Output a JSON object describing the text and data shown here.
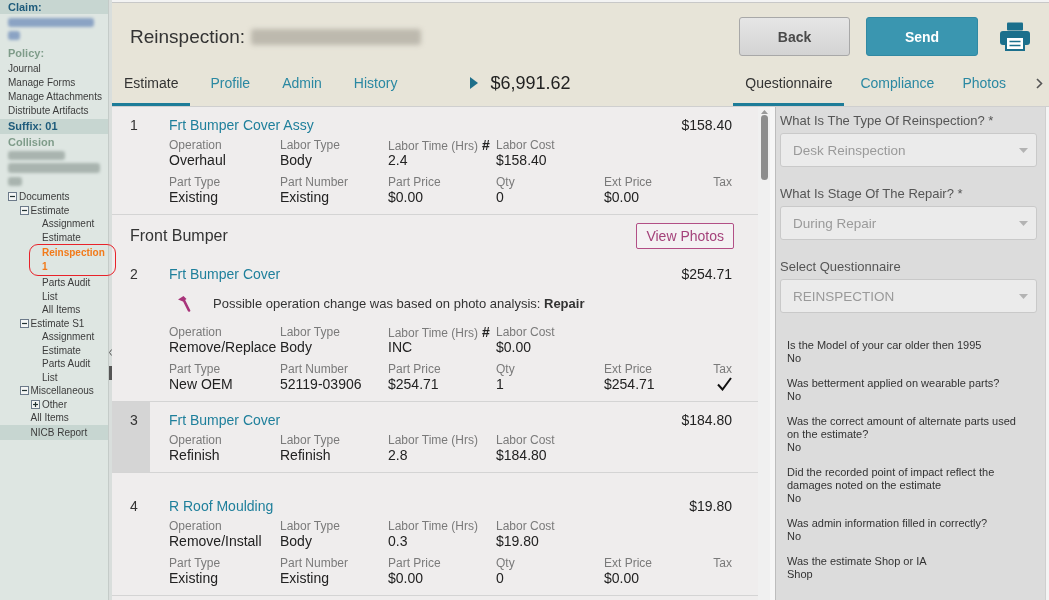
{
  "sidebar": {
    "claim_label": "Claim:",
    "policy_label": "Policy:",
    "policy_links": [
      "Journal",
      "Manage Forms",
      "Manage Attachments",
      "Distribute Artifacts"
    ],
    "suffix_label": "Suffix: 01",
    "loss_type": "Collision",
    "tree": [
      {
        "label": "Documents",
        "expanded": true,
        "selected": false,
        "hovered": false,
        "annotated": false,
        "children": [
          {
            "label": "Estimate",
            "expanded": true,
            "selected": false,
            "hovered": false,
            "annotated": false,
            "children": [
              {
                "label": "Assignment",
                "selected": false,
                "hovered": false,
                "annotated": false
              },
              {
                "label": "Estimate",
                "selected": false,
                "hovered": false,
                "annotated": false
              },
              {
                "label": "Reinspection 1",
                "selected": true,
                "hovered": false,
                "annotated": true
              },
              {
                "label": "Parts Audit List",
                "selected": false,
                "hovered": false,
                "annotated": false
              },
              {
                "label": "All Items",
                "selected": false,
                "hovered": false,
                "annotated": false
              }
            ]
          },
          {
            "label": "Estimate S1",
            "expanded": true,
            "selected": false,
            "hovered": false,
            "annotated": false,
            "children": [
              {
                "label": "Assignment",
                "selected": false,
                "hovered": false,
                "annotated": false
              },
              {
                "label": "Estimate",
                "selected": false,
                "hovered": false,
                "annotated": false
              },
              {
                "label": "Parts Audit List",
                "selected": false,
                "hovered": false,
                "annotated": false
              }
            ]
          },
          {
            "label": "Miscellaneous",
            "expanded": true,
            "selected": false,
            "hovered": false,
            "annotated": false,
            "children": [
              {
                "label": "Other",
                "expanded": false,
                "selected": false,
                "hovered": false,
                "annotated": false
              }
            ]
          },
          {
            "label": "All Items",
            "selected": false,
            "hovered": false,
            "annotated": false
          },
          {
            "label": "NICB Report",
            "selected": false,
            "hovered": true,
            "annotated": false
          }
        ]
      }
    ]
  },
  "header": {
    "title": "Reinspection:",
    "buttons": [
      {
        "label": "Back",
        "kind": "secondary"
      },
      {
        "label": "Send",
        "kind": "primary"
      }
    ],
    "tabs": [
      {
        "label": "Estimate",
        "selected": true
      },
      {
        "label": "Profile",
        "selected": false
      },
      {
        "label": "Admin",
        "selected": false
      },
      {
        "label": "History",
        "selected": false
      }
    ],
    "total": "$6,991.62",
    "side_tabs": [
      {
        "label": "Questionnaire",
        "selected": true
      },
      {
        "label": "Compliance",
        "selected": false
      },
      {
        "label": "Photos",
        "selected": false
      }
    ]
  },
  "estimate": {
    "sections": [
      {
        "lines": [
          {
            "number": "1",
            "name": "Frt Bumper Cover Assy",
            "price": "$158.40",
            "selected": false,
            "labor": [
              {
                "label": "Operation",
                "value": "Overhaul"
              },
              {
                "label": "Labor Type",
                "value": "Body"
              },
              {
                "label": "Labor Time (Hrs)",
                "flag": "#",
                "value": "2.4"
              },
              {
                "label": "Labor Cost",
                "value": "$158.40"
              }
            ],
            "parts": [
              {
                "label": "Part Type",
                "value": "Existing"
              },
              {
                "label": "Part Number",
                "value": "Existing"
              },
              {
                "label": "Part Price",
                "value": "$0.00"
              },
              {
                "label": "Qty",
                "value": "0"
              },
              {
                "label": "Ext Price",
                "value": "$0.00"
              }
            ],
            "tax": {
              "label": "Tax",
              "checked": false
            }
          }
        ]
      },
      {
        "title": "Front Bumper",
        "button": "View Photos",
        "lines": [
          {
            "number": "2",
            "name": "Frt Bumper Cover",
            "price": "$254.71",
            "selected": false,
            "note": "Possible operation change was based on photo analysis: **Repair**",
            "labor": [
              {
                "label": "Operation",
                "value": "Remove/Replace"
              },
              {
                "label": "Labor Type",
                "value": "Body"
              },
              {
                "label": "Labor Time (Hrs)",
                "flag": "#",
                "value": "INC"
              },
              {
                "label": "Labor Cost",
                "value": "$0.00"
              }
            ],
            "parts": [
              {
                "label": "Part Type",
                "value": "New OEM"
              },
              {
                "label": "Part Number",
                "value": "52119-03906"
              },
              {
                "label": "Part Price",
                "value": "$254.71"
              },
              {
                "label": "Qty",
                "value": "1"
              },
              {
                "label": "Ext Price",
                "value": "$254.71"
              }
            ],
            "tax": {
              "label": "Tax",
              "checked": true
            }
          },
          {
            "number": "3",
            "name": "Frt Bumper Cover",
            "price": "$184.80",
            "selected": true,
            "labor": [
              {
                "label": "Operation",
                "value": "Refinish"
              },
              {
                "label": "Labor Type",
                "value": "Refinish"
              },
              {
                "label": "Labor Time (Hrs)",
                "value": "2.8"
              },
              {
                "label": "Labor Cost",
                "value": "$184.80"
              }
            ]
          }
        ]
      },
      {
        "lines": [
          {
            "number": "4",
            "name": "R Roof Moulding",
            "price": "$19.80",
            "selected": false,
            "labor": [
              {
                "label": "Operation",
                "value": "Remove/Install"
              },
              {
                "label": "Labor Type",
                "value": "Body"
              },
              {
                "label": "Labor Time (Hrs)",
                "value": "0.3"
              },
              {
                "label": "Labor Cost",
                "value": "$19.80"
              }
            ],
            "parts": [
              {
                "label": "Part Type",
                "value": "Existing"
              },
              {
                "label": "Part Number",
                "value": "Existing"
              },
              {
                "label": "Part Price",
                "value": "$0.00"
              },
              {
                "label": "Qty",
                "value": "0"
              },
              {
                "label": "Ext Price",
                "value": "$0.00"
              }
            ],
            "tax": {
              "label": "Tax",
              "checked": false
            }
          }
        ]
      }
    ]
  },
  "questionnaire": {
    "selects": [
      {
        "label": "What Is The Type Of Reinspection? *",
        "value": "Desk Reinspection",
        "disabled": true
      },
      {
        "label": "What Is Stage Of The Repair? *",
        "value": "During Repair",
        "disabled": true
      },
      {
        "label": "Select Questionnaire",
        "value": "REINSPECTION",
        "disabled": true
      }
    ],
    "answers": [
      {
        "question": "Is the Model of your car older then 1995",
        "answer": "No"
      },
      {
        "question": "Was betterment applied on wearable parts?",
        "answer": "No"
      },
      {
        "question": "Was the correct amount of alternate parts used on the estimate?",
        "answer": "No"
      },
      {
        "question": "Did the recorded point of impact reflect the damages noted on the estimate",
        "answer": "No"
      },
      {
        "question": "Was admin information filled in correctly?",
        "answer": "No"
      },
      {
        "question": "Was the estimate Shop or IA",
        "answer": "Shop"
      }
    ]
  }
}
